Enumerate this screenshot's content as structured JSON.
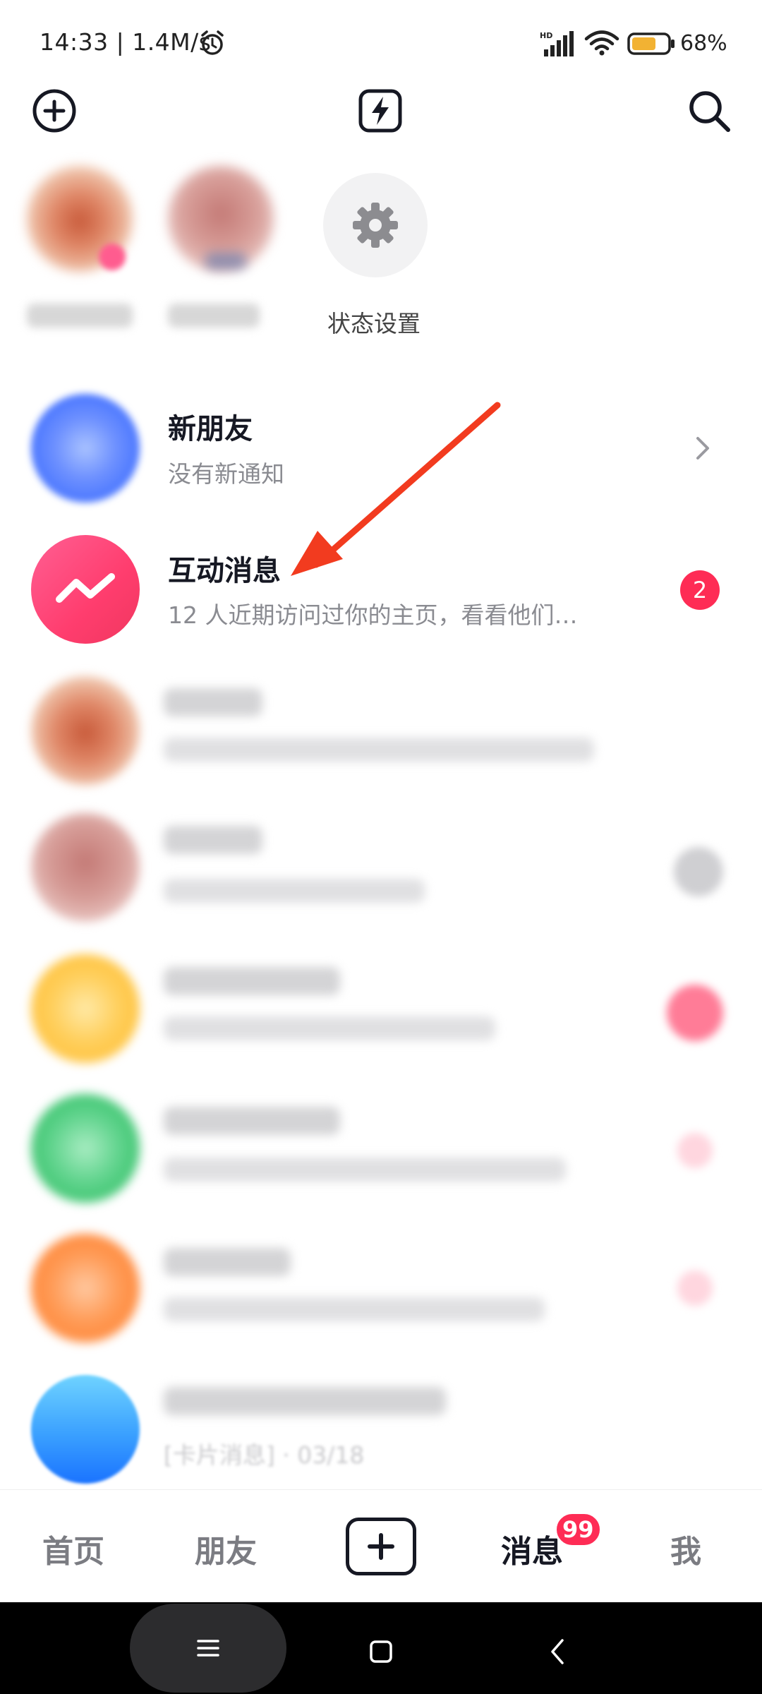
{
  "status_bar": {
    "time": "14:33 | 1.4M/s",
    "network_label": "HD",
    "battery_percent": "68%",
    "battery_level": 0.68
  },
  "top_bar": {
    "left_icon": "add-contact-icon",
    "center_icon": "flash-icon",
    "right_icon": "search-icon"
  },
  "stories": {
    "settings_label": "状态设置"
  },
  "list": {
    "new_friends": {
      "title": "新朋友",
      "subtitle": "没有新通知"
    },
    "interactions": {
      "title": "互动消息",
      "subtitle": "12 人近期访问过你的主页，看看他们…",
      "badge": "2"
    },
    "last_row_meta": "[卡片消息] · 03/18"
  },
  "bottom_nav": {
    "items": [
      {
        "label": "首页"
      },
      {
        "label": "朋友"
      },
      {
        "label": "消息",
        "badge": "99",
        "active": true
      },
      {
        "label": "我"
      }
    ]
  },
  "colors": {
    "accent": "#fe2c55",
    "annotation_arrow": "#f23b1f",
    "interaction_avatar": "#ff4a7c"
  }
}
